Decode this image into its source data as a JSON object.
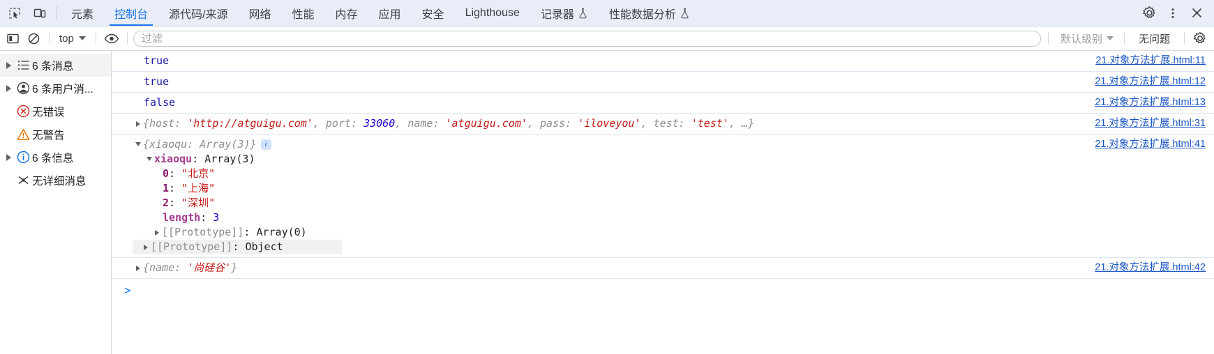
{
  "window": {
    "tabs": [
      {
        "label": "元素",
        "active": false,
        "flask": false
      },
      {
        "label": "控制台",
        "active": true,
        "flask": false
      },
      {
        "label": "源代码/来源",
        "active": false,
        "flask": false
      },
      {
        "label": "网络",
        "active": false,
        "flask": false
      },
      {
        "label": "性能",
        "active": false,
        "flask": false
      },
      {
        "label": "内存",
        "active": false,
        "flask": false
      },
      {
        "label": "应用",
        "active": false,
        "flask": false
      },
      {
        "label": "安全",
        "active": false,
        "flask": false
      },
      {
        "label": "Lighthouse",
        "active": false,
        "flask": false
      },
      {
        "label": "记录器",
        "active": false,
        "flask": true
      },
      {
        "label": "性能数据分析",
        "active": false,
        "flask": true
      }
    ],
    "left_icons": [
      {
        "name": "inspect-element-icon",
        "title": "检查"
      },
      {
        "name": "device-toolbar-icon",
        "title": "设备工具栏"
      }
    ],
    "right_icons": [
      {
        "name": "settings-gear-icon",
        "title": "设置"
      },
      {
        "name": "more-options-icon",
        "title": "更多选项"
      },
      {
        "name": "close-devtools-icon",
        "title": "关闭"
      }
    ]
  },
  "toolbar": {
    "sidebar_toggle": "显示控制台边栏",
    "clear_console": "清除控制台",
    "context_label": "top",
    "eye_label": "创建实时表达式",
    "filter_placeholder": "过滤",
    "filter_value": "",
    "levels_label": "默认级别",
    "issues_label": "无问题",
    "settings_label": "控制台设置"
  },
  "sidebar": {
    "items": [
      {
        "label": "6 条消息",
        "icon": "list-icon",
        "expandable": true,
        "selected": true
      },
      {
        "label": "6 条用户消...",
        "icon": "user-message-icon",
        "expandable": true,
        "selected": false
      },
      {
        "label": "无错误",
        "icon": "error-icon",
        "expandable": false,
        "selected": false
      },
      {
        "label": "无警告",
        "icon": "warning-icon",
        "expandable": false,
        "selected": false
      },
      {
        "label": "6 条信息",
        "icon": "info-icon",
        "expandable": true,
        "selected": false
      },
      {
        "label": "无详细消息",
        "icon": "verbose-icon",
        "expandable": false,
        "selected": false
      }
    ]
  },
  "console": {
    "messages": [
      {
        "type": "bool",
        "value": "true",
        "link": "21.对象方法扩展.html:11"
      },
      {
        "type": "bool",
        "value": "true",
        "link": "21.对象方法扩展.html:12"
      },
      {
        "type": "bool",
        "value": "false",
        "link": "21.对象方法扩展.html:13"
      },
      {
        "type": "object_collapsed",
        "link": "21.对象方法扩展.html:31",
        "preview": {
          "open": "{",
          "entries": [
            {
              "key": "host",
              "sep": ": ",
              "value": "'http://atguigu.com'",
              "vtype": "str",
              "comma": ", "
            },
            {
              "key": "port",
              "sep": ": ",
              "value": "33060",
              "vtype": "num",
              "comma": ", "
            },
            {
              "key": "name",
              "sep": ": ",
              "value": "'atguigu.com'",
              "vtype": "str",
              "comma": ", "
            },
            {
              "key": "pass",
              "sep": ": ",
              "value": "'iloveyou'",
              "vtype": "str",
              "comma": ", "
            },
            {
              "key": "test",
              "sep": ": ",
              "value": "'test'",
              "vtype": "str",
              "comma": ", "
            }
          ],
          "ellipsis": "…",
          "close": "}"
        }
      },
      {
        "type": "object_expanded",
        "link": "21.对象方法扩展.html:41",
        "header": "{xiaoqu: Array(3)}",
        "info_badge": "i",
        "tree": [
          {
            "indent": 1,
            "arrow": "down",
            "name": "xiaoqu",
            "sep": ": ",
            "value": "Array(3)",
            "vtype": "plain",
            "style": "prop"
          },
          {
            "indent": 2,
            "arrow": "none",
            "name": "0",
            "sep": ": ",
            "value": "\"北京\"",
            "vtype": "cjkstr",
            "style": "idx"
          },
          {
            "indent": 2,
            "arrow": "none",
            "name": "1",
            "sep": ": ",
            "value": "\"上海\"",
            "vtype": "cjkstr",
            "style": "idx"
          },
          {
            "indent": 2,
            "arrow": "none",
            "name": "2",
            "sep": ": ",
            "value": "\"深圳\"",
            "vtype": "cjkstr",
            "style": "idx"
          },
          {
            "indent": 2,
            "arrow": "none",
            "name": "length",
            "sep": ": ",
            "value": "3",
            "vtype": "num2",
            "style": "prop"
          },
          {
            "indent": 2,
            "arrow": "right",
            "name": "[[Prototype]]",
            "sep": ": ",
            "value": "Array(0)",
            "vtype": "plain",
            "style": "proto"
          },
          {
            "indent": 1,
            "arrow": "right",
            "name": "[[Prototype]]",
            "sep": ": ",
            "value": "Object",
            "vtype": "plain",
            "style": "proto",
            "highlight": true
          }
        ]
      },
      {
        "type": "object_collapsed2",
        "link": "21.对象方法扩展.html:42",
        "preview2": {
          "open": "{",
          "key": "name",
          "sep": ": ",
          "value": "'尚硅谷'",
          "close": "}"
        }
      }
    ],
    "prompt_symbol": ">",
    "prompt_value": ""
  },
  "colors": {
    "accent": "#1a73e8",
    "link": "#1a56c4",
    "string": "#c41a16",
    "number": "#1c00cf",
    "boolean": "#1a1aa6",
    "key": "#8c8c8c",
    "prop": "#a33b8f",
    "tabbar_bg": "#e9edf7",
    "error": "#d93025",
    "warning": "#e37400",
    "info": "#1a73e8"
  }
}
